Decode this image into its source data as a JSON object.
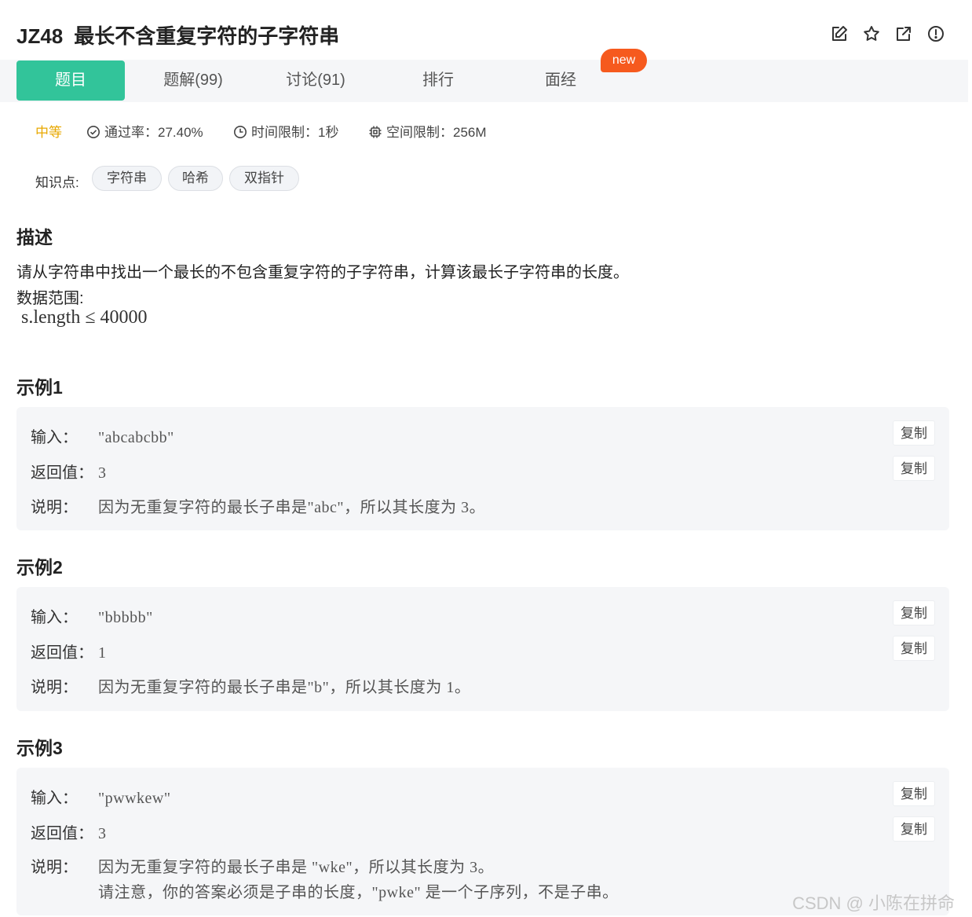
{
  "header": {
    "problem_id": "JZ48",
    "problem_title": "最长不含重复字符的子字符串",
    "icons": [
      "edit-icon",
      "star-icon",
      "share-icon",
      "report-icon"
    ]
  },
  "tabs": [
    {
      "label": "题目",
      "active": true
    },
    {
      "label": "题解(99)",
      "active": false
    },
    {
      "label": "讨论(91)",
      "active": false
    },
    {
      "label": "排行",
      "active": false
    },
    {
      "label": "面经",
      "active": false
    }
  ],
  "badge_new": "new",
  "meta": {
    "difficulty": "中等",
    "pass_rate": "通过率：27.40%",
    "time_limit": "时间限制：1秒",
    "space_limit": "空间限制：256M"
  },
  "knowledge": {
    "label": "知识点:",
    "tags": [
      "字符串",
      "哈希",
      "双指针"
    ]
  },
  "description": {
    "heading": "描述",
    "text": "请从字符串中找出一个最长的不包含重复字符的子字符串，计算该最长子字符串的长度。",
    "range_label": "数据范围:",
    "range_math": "s.length ≤ 40000"
  },
  "copy_label": "复制",
  "labels": {
    "input": "输入：",
    "output": "返回值：",
    "explain": "说明："
  },
  "examples": [
    {
      "heading": "示例1",
      "input": "\"abcabcbb\"",
      "output": "3",
      "explain": "因为无重复字符的最长子串是\"abc\"，所以其长度为 3。"
    },
    {
      "heading": "示例2",
      "input": "\"bbbbb\"",
      "output": "1",
      "explain": "因为无重复字符的最长子串是\"b\"，所以其长度为 1。"
    },
    {
      "heading": "示例3",
      "input": "\"pwwkew\"",
      "output": "3",
      "explain": "因为无重复字符的最长子串是 \"wke\"，所以其长度为 3。",
      "explain2": "请注意，你的答案必须是子串的长度，\"pwke\" 是一个子序列，不是子串。"
    }
  ],
  "watermark": "CSDN @ 小陈在拼命"
}
